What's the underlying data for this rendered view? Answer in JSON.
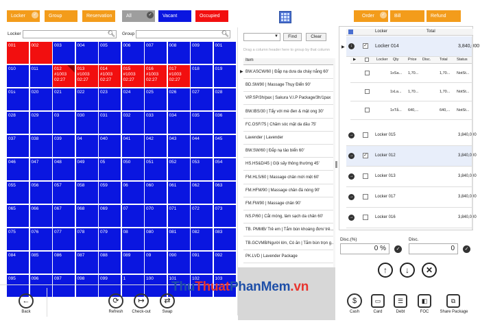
{
  "top_buttons": {
    "locker": "Locker",
    "group": "Group",
    "reservation": "Reservation",
    "all": "All",
    "vacant": "Vacant",
    "occupied": "Occupied"
  },
  "right_buttons": {
    "order": "Order",
    "bill": "Bill",
    "refund": "Refund"
  },
  "filters": {
    "locker_label": "Locker",
    "group_label": "Group"
  },
  "cells": [
    {
      "n": "001",
      "s": "occ"
    },
    {
      "n": "002",
      "s": "occ"
    },
    {
      "n": "003"
    },
    {
      "n": "004"
    },
    {
      "n": "005"
    },
    {
      "n": "006"
    },
    {
      "n": "007"
    },
    {
      "n": "008"
    },
    {
      "n": "009"
    },
    {
      "n": "001"
    },
    {
      "n": "010"
    },
    {
      "n": "011"
    },
    {
      "n": "012",
      "s": "occ",
      "a": "#1003",
      "t": "02:27",
      "mark": 1
    },
    {
      "n": "013",
      "s": "occ",
      "a": "#1003",
      "t": "02:27"
    },
    {
      "n": "014",
      "s": "occ",
      "a": "#1003",
      "t": "02:27"
    },
    {
      "n": "015",
      "s": "occ",
      "a": "#1003",
      "t": "02:27"
    },
    {
      "n": "016",
      "s": "occ",
      "a": "#1003",
      "t": "02:27"
    },
    {
      "n": "017",
      "s": "occ",
      "a": "#1003",
      "t": "02:27"
    },
    {
      "n": "018"
    },
    {
      "n": "019"
    },
    {
      "n": "01s"
    },
    {
      "n": "020"
    },
    {
      "n": "021"
    },
    {
      "n": "022"
    },
    {
      "n": "023"
    },
    {
      "n": "024"
    },
    {
      "n": "025"
    },
    {
      "n": "026"
    },
    {
      "n": "027"
    },
    {
      "n": "028"
    },
    {
      "n": "028"
    },
    {
      "n": "029"
    },
    {
      "n": "03"
    },
    {
      "n": "030"
    },
    {
      "n": "031"
    },
    {
      "n": "032"
    },
    {
      "n": "033"
    },
    {
      "n": "034"
    },
    {
      "n": "035"
    },
    {
      "n": "036"
    },
    {
      "n": "037"
    },
    {
      "n": "038"
    },
    {
      "n": "039"
    },
    {
      "n": "04"
    },
    {
      "n": "040"
    },
    {
      "n": "041"
    },
    {
      "n": "042"
    },
    {
      "n": "043"
    },
    {
      "n": "044"
    },
    {
      "n": "045"
    },
    {
      "n": "046"
    },
    {
      "n": "047"
    },
    {
      "n": "048"
    },
    {
      "n": "049"
    },
    {
      "n": "05"
    },
    {
      "n": "050"
    },
    {
      "n": "051"
    },
    {
      "n": "052"
    },
    {
      "n": "053"
    },
    {
      "n": "054"
    },
    {
      "n": "055"
    },
    {
      "n": "056"
    },
    {
      "n": "057"
    },
    {
      "n": "058"
    },
    {
      "n": "059"
    },
    {
      "n": "06"
    },
    {
      "n": "060"
    },
    {
      "n": "061"
    },
    {
      "n": "062"
    },
    {
      "n": "063"
    },
    {
      "n": "065"
    },
    {
      "n": "066"
    },
    {
      "n": "067"
    },
    {
      "n": "068"
    },
    {
      "n": "069"
    },
    {
      "n": "07"
    },
    {
      "n": "070"
    },
    {
      "n": "071"
    },
    {
      "n": "072"
    },
    {
      "n": "073"
    },
    {
      "n": "075"
    },
    {
      "n": "076"
    },
    {
      "n": "077"
    },
    {
      "n": "078"
    },
    {
      "n": "079"
    },
    {
      "n": "08"
    },
    {
      "n": "080"
    },
    {
      "n": "081"
    },
    {
      "n": "082"
    },
    {
      "n": "083"
    },
    {
      "n": "084"
    },
    {
      "n": "085"
    },
    {
      "n": "086"
    },
    {
      "n": "087"
    },
    {
      "n": "088"
    },
    {
      "n": "089"
    },
    {
      "n": "09"
    },
    {
      "n": "090"
    },
    {
      "n": "091"
    },
    {
      "n": "092"
    },
    {
      "n": "095"
    },
    {
      "n": "096"
    },
    {
      "n": "097"
    },
    {
      "n": "098"
    },
    {
      "n": "099"
    },
    {
      "n": "1"
    },
    {
      "n": "100"
    },
    {
      "n": "101"
    },
    {
      "n": "102"
    },
    {
      "n": "103"
    },
    {
      "n": "104"
    }
  ],
  "middle": {
    "find": "Find",
    "clear": "Clear",
    "group_hint": "Drag a column header here to group by that column",
    "col_item": "Item",
    "items": [
      "BW.ASCW/60 | Đắp nạ dưa da cháy nắng 60'",
      "BD.SM/90 | Massage Thụy Điển 90'",
      "VIP.SP/3h/pax | Sakura V.I.P Package/3h/1pax",
      "BW.IBS/30 | Tẩy với mè đen & mật ong 30'",
      "FC.OSF/75 | Chăm sóc mặt da dầu 75'",
      "Lavender | Lavender",
      "BW.SW/60 | Đắp nạ tảo biển 60'",
      "HS.HS&D/45 | Gội sấy thông thường 45'",
      "FM.HLS/60 | Massage chân mới mệt 60'",
      "FM.HFM/90 | Massage chân đá nóng 90'",
      "FM.FM/90 | Massage chân 90'",
      "NS.P/60 | Cắt móng, làm sạch da chân 60'",
      "TB. PMMB/ Trẻ em | Tắm bùn khoáng đơn/ trẻ...",
      "TB.GCVMB/Người lớn, Có ăn | Tắm bùn trọn g...",
      "PK.LVD | Lavender Package"
    ]
  },
  "order": {
    "col_locker": "Locker",
    "col_total": "Total",
    "expanded_locker": "Locker 014",
    "expanded_total": "3,840,000",
    "sub_cols": [
      "Locker",
      "Qty",
      "Price",
      "Disc.",
      "Total",
      "Status"
    ],
    "sub_rows": [
      {
        "name": "1xSa...",
        "price": "1,70...",
        "total": "1,70...",
        "status": "NotSt..."
      },
      {
        "name": "1xLa...",
        "price": "1,70...",
        "total": "1,70...",
        "status": "NotSt..."
      },
      {
        "name": "1xTắ...",
        "price": "640,...",
        "total": "640,...",
        "status": "NotSt..."
      }
    ],
    "rows": [
      {
        "locker": "Locker 015",
        "total": "3,840,000",
        "checked": false
      },
      {
        "locker": "Locker 012",
        "total": "3,840,000",
        "checked": true
      },
      {
        "locker": "Locker 013",
        "total": "3,840,000",
        "checked": false
      },
      {
        "locker": "Locker 017",
        "total": "3,840,000",
        "checked": false
      },
      {
        "locker": "Locker 016",
        "total": "3,840,000",
        "checked": false
      }
    ],
    "disc_pct_label": "Disc.(%)",
    "disc_label": "Disc.",
    "disc_pct_value": "0 %",
    "disc_value": "0"
  },
  "bottom": {
    "back": "Back",
    "refresh": "Refresh",
    "checkout": "Check-out",
    "swap": "Swap",
    "cash": "Cash",
    "card": "Card",
    "debt": "Debt",
    "foc": "FOC",
    "share": "Share Package"
  },
  "watermark": {
    "a": "Thu",
    "b": "Thuat",
    "c": "PhanMem",
    ".vn": ".vn"
  },
  "colors": {
    "orange": "#f39c1b",
    "vacant": "#0a16e0",
    "occupied": "#f20f0f",
    "all": "#9e9e9e",
    "accent": "#4a6fd0"
  }
}
